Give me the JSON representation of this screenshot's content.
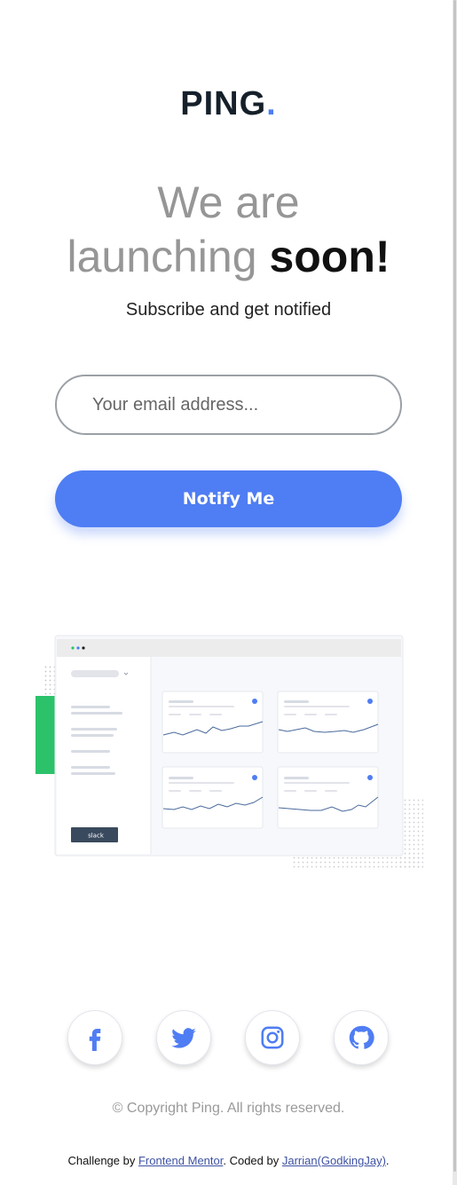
{
  "logo": {
    "text": "PING",
    "dot": "."
  },
  "headline": {
    "line1": "We are",
    "line2_light": "launching",
    "line2_bold": "soon!"
  },
  "subtitle": "Subscribe and get notified",
  "form": {
    "email_placeholder": "Your email address...",
    "button_label": "Notify Me"
  },
  "illustration": {
    "slack_label": "slack"
  },
  "social": {
    "items": [
      {
        "name": "facebook",
        "icon": "facebook-icon"
      },
      {
        "name": "twitter",
        "icon": "twitter-icon"
      },
      {
        "name": "instagram",
        "icon": "instagram-icon"
      },
      {
        "name": "github",
        "icon": "github-icon"
      }
    ]
  },
  "footer": {
    "copyright": "© Copyright Ping. All rights reserved.",
    "challenge_prefix": "Challenge by ",
    "challenge_link": "Frontend Mentor",
    "coded_prefix": ". Coded by ",
    "coded_link": "Jarrian(GodkingJay)",
    "suffix": "."
  },
  "colors": {
    "accent": "#4f7df3",
    "text_dark": "#15202a",
    "text_gray": "#969696"
  }
}
